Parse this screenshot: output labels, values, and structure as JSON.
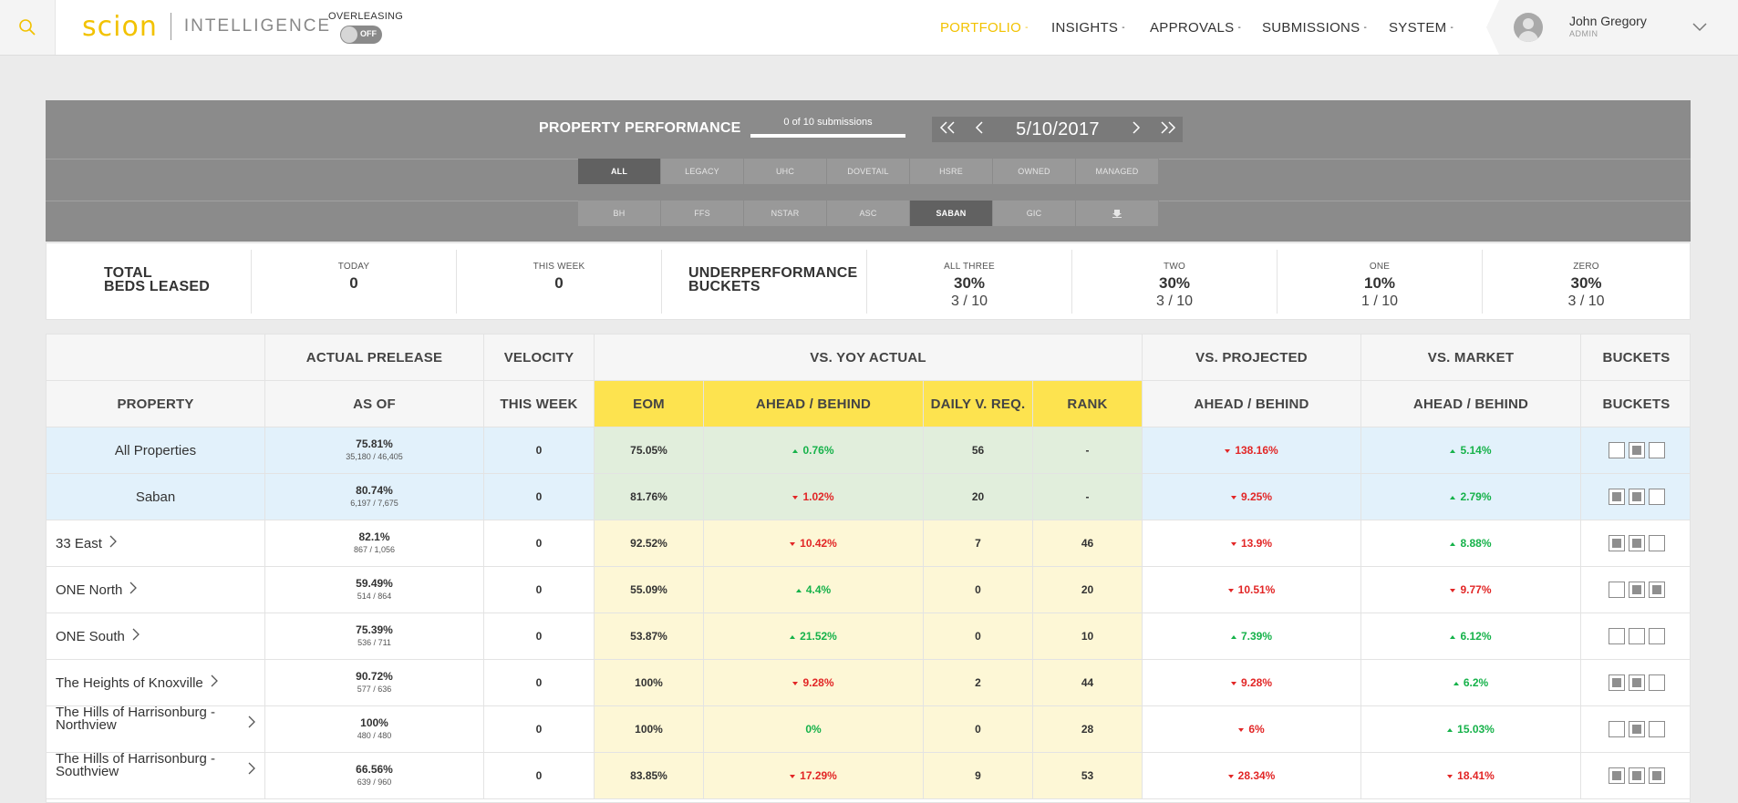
{
  "header": {
    "logo_brand": "scion",
    "logo_product": "INTELLIGENCE",
    "overleasing_label": "OVERLEASING",
    "overleasing_state": "OFF",
    "nav": [
      {
        "label": "PORTFOLIO",
        "active": true
      },
      {
        "label": "INSIGHTS",
        "active": false
      },
      {
        "label": "APPROVALS",
        "active": false
      },
      {
        "label": "SUBMISSIONS",
        "active": false
      },
      {
        "label": "SYSTEM",
        "active": false
      }
    ],
    "nav_caret": "-",
    "user_name": "John Gregory",
    "user_role": "ADMIN"
  },
  "performance": {
    "title": "PROPERTY PERFORMANCE",
    "submissions": "0 of 10 submissions",
    "date": "5/10/2017",
    "filters_row1": [
      {
        "label": "ALL",
        "active": true
      },
      {
        "label": "LEGACY",
        "active": false
      },
      {
        "label": "UHC",
        "active": false
      },
      {
        "label": "DOVETAIL",
        "active": false
      },
      {
        "label": "HSRE",
        "active": false
      },
      {
        "label": "OWNED",
        "active": false
      },
      {
        "label": "MANAGED",
        "active": false
      }
    ],
    "filters_row2": [
      {
        "label": "BH",
        "active": false
      },
      {
        "label": "FFS",
        "active": false
      },
      {
        "label": "NSTAR",
        "active": false
      },
      {
        "label": "ASC",
        "active": false
      },
      {
        "label": "SABAN",
        "active": true
      },
      {
        "label": "GIC",
        "active": false
      },
      {
        "label": "download-icon",
        "active": false
      }
    ]
  },
  "stats": {
    "total_line1": "TOTAL",
    "total_line2": "BEDS LEASED",
    "today_label": "TODAY",
    "today_value": "0",
    "week_label": "THIS WEEK",
    "week_value": "0",
    "under_line1": "UNDERPERFORMANCE",
    "under_line2": "BUCKETS",
    "buckets": [
      {
        "label": "ALL THREE",
        "pct": "30%",
        "count": "3 / 10"
      },
      {
        "label": "TWO",
        "pct": "30%",
        "count": "3 / 10"
      },
      {
        "label": "ONE",
        "pct": "10%",
        "count": "1 / 10"
      },
      {
        "label": "ZERO",
        "pct": "30%",
        "count": "3 / 10"
      }
    ]
  },
  "table": {
    "group_headers": [
      "ACTUAL PRELEASE",
      "VELOCITY",
      "VS. YOY ACTUAL",
      "VS. PROJECTED",
      "VS. MARKET",
      "BUCKETS"
    ],
    "column_headers": [
      "PROPERTY",
      "AS OF",
      "THIS WEEK",
      "EOM",
      "AHEAD / BEHIND",
      "DAILY V. REQ.",
      "RANK",
      "AHEAD / BEHIND",
      "AHEAD / BEHIND",
      "BUCKETS"
    ],
    "rows": [
      {
        "name": "All Properties",
        "pct": "75.81%",
        "frac": "35,180 / 46,405",
        "week": "0",
        "eom": "75.05%",
        "yoy": "0.76%",
        "yoy_dir": "up",
        "daily": "56",
        "rank": "-",
        "proj": "138.16%",
        "proj_dir": "down",
        "mkt": "5.14%",
        "mkt_dir": "up",
        "buckets": [
          false,
          true,
          false
        ],
        "summary": true,
        "link": false
      },
      {
        "name": "Saban",
        "pct": "80.74%",
        "frac": "6,197 / 7,675",
        "week": "0",
        "eom": "81.76%",
        "yoy": "1.02%",
        "yoy_dir": "down",
        "daily": "20",
        "rank": "-",
        "proj": "9.25%",
        "proj_dir": "down",
        "mkt": "2.79%",
        "mkt_dir": "up",
        "buckets": [
          true,
          true,
          false
        ],
        "summary": true,
        "link": false
      },
      {
        "name": "33 East",
        "pct": "82.1%",
        "frac": "867 / 1,056",
        "week": "0",
        "eom": "92.52%",
        "yoy": "10.42%",
        "yoy_dir": "down",
        "daily": "7",
        "rank": "46",
        "proj": "13.9%",
        "proj_dir": "down",
        "mkt": "8.88%",
        "mkt_dir": "up",
        "buckets": [
          true,
          true,
          false
        ],
        "summary": false,
        "link": true
      },
      {
        "name": "ONE North",
        "pct": "59.49%",
        "frac": "514 / 864",
        "week": "0",
        "eom": "55.09%",
        "yoy": "4.4%",
        "yoy_dir": "up",
        "daily": "0",
        "rank": "20",
        "proj": "10.51%",
        "proj_dir": "down",
        "mkt": "9.77%",
        "mkt_dir": "down",
        "buckets": [
          false,
          true,
          true
        ],
        "summary": false,
        "link": true
      },
      {
        "name": "ONE South",
        "pct": "75.39%",
        "frac": "536 / 711",
        "week": "0",
        "eom": "53.87%",
        "yoy": "21.52%",
        "yoy_dir": "up",
        "daily": "0",
        "rank": "10",
        "proj": "7.39%",
        "proj_dir": "up",
        "mkt": "6.12%",
        "mkt_dir": "up",
        "buckets": [
          false,
          false,
          false
        ],
        "summary": false,
        "link": true
      },
      {
        "name": "The Heights of Knoxville",
        "pct": "90.72%",
        "frac": "577 / 636",
        "week": "0",
        "eom": "100%",
        "yoy": "9.28%",
        "yoy_dir": "down",
        "daily": "2",
        "rank": "44",
        "proj": "9.28%",
        "proj_dir": "down",
        "mkt": "6.2%",
        "mkt_dir": "up",
        "buckets": [
          true,
          true,
          false
        ],
        "summary": false,
        "link": true
      },
      {
        "name": "The Hills of Harrisonburg - Northview",
        "name1": "The Hills of Harrisonburg -",
        "name2": "Northview",
        "pct": "100%",
        "frac": "480 / 480",
        "week": "0",
        "eom": "100%",
        "yoy": "0%",
        "yoy_dir": "none",
        "daily": "0",
        "rank": "28",
        "proj": "6%",
        "proj_dir": "down",
        "mkt": "15.03%",
        "mkt_dir": "up",
        "buckets": [
          false,
          true,
          false
        ],
        "summary": false,
        "link": true
      },
      {
        "name": "The Hills of Harrisonburg - Southview",
        "name1": "The Hills of Harrisonburg -",
        "name2": "Southview",
        "pct": "66.56%",
        "frac": "639 / 960",
        "week": "0",
        "eom": "83.85%",
        "yoy": "17.29%",
        "yoy_dir": "down",
        "daily": "9",
        "rank": "53",
        "proj": "28.34%",
        "proj_dir": "down",
        "mkt": "18.41%",
        "mkt_dir": "down",
        "buckets": [
          true,
          true,
          true
        ],
        "summary": false,
        "link": true
      }
    ]
  },
  "colors": {
    "brand_yellow": "#f2c200",
    "header_yellow": "#fde34f",
    "yoy_bg_summary": "#e1eedc",
    "yoy_bg_row": "#fdf7d6",
    "summary_bg": "#e2f1fb",
    "up": "#16b24a",
    "down": "#e22626"
  }
}
